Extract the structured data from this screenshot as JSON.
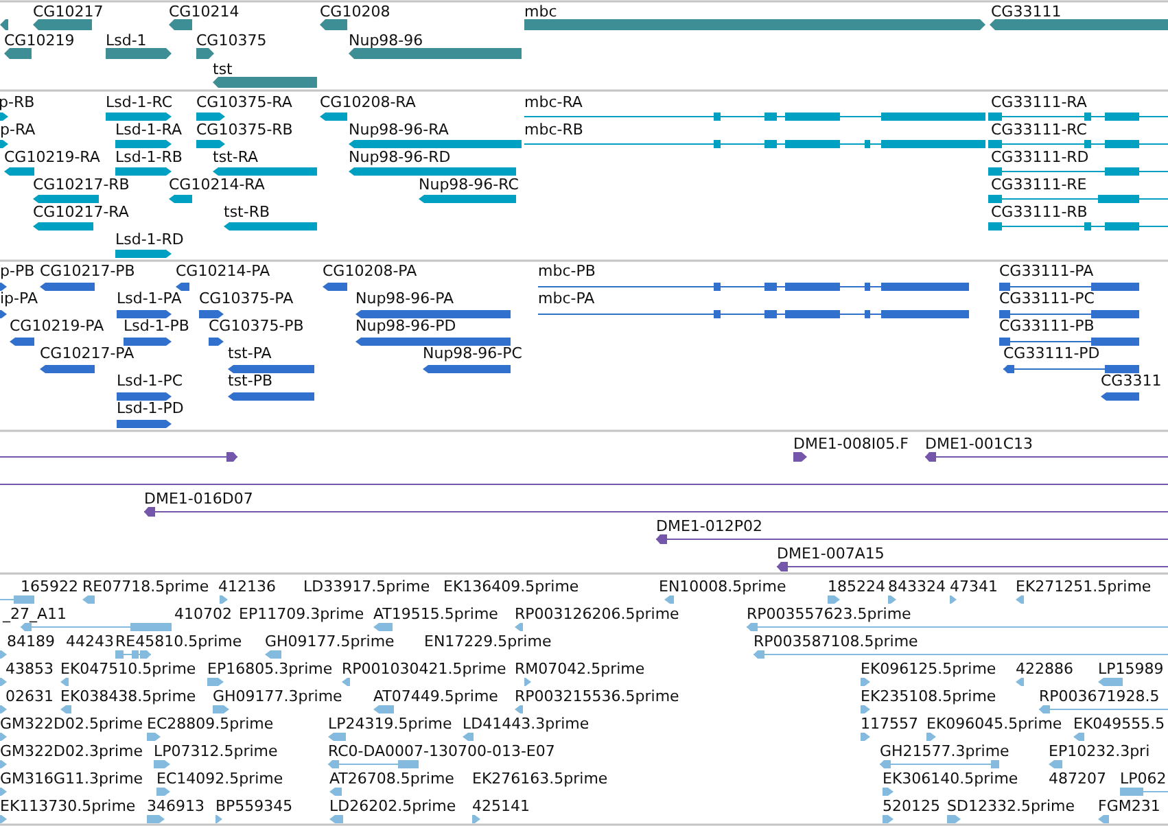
{
  "tracks": [
    {
      "kind": "gene",
      "rows": [
        {
          "features": [
            {
              "reverse": true
            },
            {
              "label": "CG10217",
              "reverse": true
            },
            {
              "label": "CG10214",
              "reverse": true
            },
            {
              "label": "CG10208",
              "reverse": true
            },
            {
              "label": "mbc",
              "reverse": false
            },
            {
              "label": "CG33111",
              "reverse": true
            }
          ]
        },
        {
          "features": [
            {
              "label": "CG10219",
              "reverse": true
            },
            {
              "label": "Lsd-1",
              "reverse": false
            },
            {
              "label": "CG10375",
              "reverse": false
            },
            {
              "label": "Nup98-96",
              "reverse": true
            }
          ]
        },
        {
          "features": [
            {
              "label": "tst",
              "reverse": true
            }
          ]
        }
      ]
    },
    {
      "kind": "transcript",
      "rows": [
        {
          "features": [
            {
              "label": "p-RB",
              "reverse": false
            },
            {
              "label": "Lsd-1-RC",
              "reverse": false
            },
            {
              "label": "CG10375-RA",
              "reverse": false
            },
            {
              "label": "CG10208-RA",
              "reverse": true
            },
            {
              "label": "mbc-RA",
              "reverse": false
            },
            {
              "label": "CG33111-RA",
              "reverse": true
            }
          ]
        },
        {
          "features": [
            {
              "label": "p-RA",
              "reverse": false
            },
            {
              "label": "Lsd-1-RA",
              "reverse": false
            },
            {
              "label": "CG10375-RB",
              "reverse": false
            },
            {
              "label": "Nup98-96-RA",
              "reverse": true
            },
            {
              "label": "mbc-RB",
              "reverse": false
            },
            {
              "label": "CG33111-RC",
              "reverse": true
            }
          ]
        },
        {
          "features": [
            {
              "label": "CG10219-RA",
              "reverse": true
            },
            {
              "label": "Lsd-1-RB",
              "reverse": false
            },
            {
              "label": "tst-RA",
              "reverse": true
            },
            {
              "label": "Nup98-96-RD",
              "reverse": true
            },
            {
              "label": "CG33111-RD",
              "reverse": true
            }
          ]
        },
        {
          "features": [
            {
              "label": "CG10217-RB",
              "reverse": true
            },
            {
              "label": "CG10214-RA",
              "reverse": true
            },
            {
              "label": "Nup98-96-RC",
              "reverse": true
            },
            {
              "label": "CG33111-RE",
              "reverse": true
            }
          ]
        },
        {
          "features": [
            {
              "label": "CG10217-RA",
              "reverse": true
            },
            {
              "label": "tst-RB",
              "reverse": true
            },
            {
              "label": "CG33111-RB",
              "reverse": true
            }
          ]
        },
        {
          "features": [
            {
              "label": "Lsd-1-RD",
              "reverse": false
            }
          ]
        }
      ]
    },
    {
      "kind": "protein",
      "rows": [
        {
          "features": [
            {
              "label": "p-PB",
              "reverse": false
            },
            {
              "label": "CG10217-PB",
              "reverse": true
            },
            {
              "label": "CG10214-PA",
              "reverse": true
            },
            {
              "label": "CG10208-PA",
              "reverse": true
            },
            {
              "label": "mbc-PB",
              "reverse": false
            },
            {
              "label": "CG33111-PA",
              "reverse": true
            }
          ]
        },
        {
          "features": [
            {
              "label": "ip-PA",
              "reverse": false
            },
            {
              "label": "Lsd-1-PA",
              "reverse": false
            },
            {
              "label": "CG10375-PA",
              "reverse": false
            },
            {
              "label": "Nup98-96-PA",
              "reverse": true
            },
            {
              "label": "mbc-PA",
              "reverse": false
            },
            {
              "label": "CG33111-PC",
              "reverse": true
            }
          ]
        },
        {
          "features": [
            {
              "label": "CG10219-PA",
              "reverse": true
            },
            {
              "label": "Lsd-1-PB",
              "reverse": false
            },
            {
              "label": "CG10375-PB",
              "reverse": false
            },
            {
              "label": "Nup98-96-PD",
              "reverse": true
            },
            {
              "label": "CG33111-PB",
              "reverse": true
            }
          ]
        },
        {
          "features": [
            {
              "label": "CG10217-PA",
              "reverse": true
            },
            {
              "label": "tst-PA",
              "reverse": true
            },
            {
              "label": "Nup98-96-PC",
              "reverse": true
            },
            {
              "label": "CG33111-PD",
              "reverse": true
            }
          ]
        },
        {
          "features": [
            {
              "label": "Lsd-1-PC",
              "reverse": false
            },
            {
              "label": "tst-PB",
              "reverse": true
            },
            {
              "label": "CG3311",
              "reverse": true
            }
          ]
        },
        {
          "features": [
            {
              "label": "Lsd-1-PD",
              "reverse": false
            }
          ]
        }
      ]
    },
    {
      "kind": "clone",
      "rows": [
        {
          "features": [
            {
              "reverse": false
            },
            {
              "label": "DME1-008I05.F",
              "reverse": false
            },
            {
              "label": "DME1-001C13",
              "reverse": true
            }
          ]
        },
        {
          "features": [
            {
              "both_ends_offscreen": true
            }
          ]
        },
        {
          "features": [
            {
              "label": "DME1-016D07",
              "reverse": true
            }
          ]
        },
        {
          "features": [
            {
              "label": "DME1-012P02",
              "reverse": true
            }
          ]
        },
        {
          "features": [
            {
              "label": "DME1-007A15",
              "reverse": true
            }
          ]
        }
      ]
    },
    {
      "kind": "est",
      "rows": [
        {
          "features": [
            {
              "label": "165922",
              "reverse": false
            },
            {
              "label": "RE07718.5prime",
              "reverse": true
            },
            {
              "label": "412136",
              "reverse": false
            },
            {
              "label": "LD33917.5prime"
            },
            {
              "label": "EK136409.5prime"
            },
            {
              "label": "EN10008.5prime",
              "reverse": true
            },
            {
              "label": "185224",
              "reverse": false
            },
            {
              "label": "843324",
              "reverse": false
            },
            {
              "label": "47341",
              "reverse": false
            },
            {
              "label": "EK271251.5prime",
              "reverse": true
            }
          ]
        },
        {
          "features": [
            {
              "label": "_27_A11",
              "reverse": true
            },
            {
              "label": "410702"
            },
            {
              "label": "EP11709.3prime"
            },
            {
              "label": "AT19515.5prime",
              "reverse": true
            },
            {
              "label": "RP003126206.5prime",
              "reverse": true
            },
            {
              "label": "RP003557623.5prime",
              "reverse": true
            }
          ]
        },
        {
          "features": [
            {
              "label": "84189",
              "reverse": false
            },
            {
              "label": "44243"
            },
            {
              "label": "RE45810.5prime",
              "reverse": false
            },
            {
              "label": "GH09177.5prime",
              "reverse": true
            },
            {
              "label": "EN17229.5prime"
            },
            {
              "label": "RP003587108.5prime",
              "reverse": true
            }
          ]
        },
        {
          "features": [
            {
              "label": "43853",
              "reverse": false
            },
            {
              "label": "EK047510.5prime",
              "reverse": true
            },
            {
              "label": "EP16805.3prime",
              "reverse": false
            },
            {
              "label": "RP001030421.5prime",
              "reverse": true
            },
            {
              "label": "RM07042.5prime",
              "reverse": false
            },
            {
              "label": "EK096125.5prime",
              "reverse": false
            },
            {
              "label": "422886",
              "reverse": true
            },
            {
              "label": "LP15989",
              "reverse": true
            }
          ]
        },
        {
          "features": [
            {
              "label": "02631",
              "reverse": false
            },
            {
              "label": "EK038438.5prime",
              "reverse": true
            },
            {
              "label": "GH09177.3prime",
              "reverse": false
            },
            {
              "label": "AT07449.5prime",
              "reverse": true
            },
            {
              "label": "RP003215536.5prime",
              "reverse": true
            },
            {
              "label": "EK235108.5prime",
              "reverse": false
            },
            {
              "label": "RP003671928.5",
              "reverse": true
            }
          ]
        },
        {
          "features": [
            {
              "label": "GM322D02.5prime",
              "reverse": false
            },
            {
              "label": "EC28809.5prime",
              "reverse": false
            },
            {
              "label": "LP24319.5prime",
              "reverse": true
            },
            {
              "label": "LD41443.3prime",
              "reverse": true
            },
            {
              "label": "117557",
              "reverse": false
            },
            {
              "label": "EK096045.5prime",
              "reverse": false
            },
            {
              "label": "EK049555.5",
              "reverse": true
            }
          ]
        },
        {
          "features": [
            {
              "label": "GM322D02.3prime",
              "reverse": false
            },
            {
              "label": "LP07312.5prime",
              "reverse": false
            },
            {
              "label": "RC0-DA0007-130700-013-E07",
              "reverse": true
            },
            {
              "label": "GH21577.3prime",
              "reverse": true
            },
            {
              "label": "EP10232.3pri",
              "reverse": true
            }
          ]
        },
        {
          "features": [
            {
              "label": "GM316G11.3prime",
              "reverse": false
            },
            {
              "label": "EC14092.5prime",
              "reverse": false
            },
            {
              "label": "AT26708.5prime",
              "reverse": true
            },
            {
              "label": "EK276163.5prime"
            },
            {
              "label": "EK306140.5prime",
              "reverse": false
            },
            {
              "label": "487207"
            },
            {
              "label": "LP062",
              "reverse": true
            }
          ]
        },
        {
          "features": [
            {
              "label": "EK113730.5prime",
              "reverse": false
            },
            {
              "label": "346913",
              "reverse": false
            },
            {
              "label": "BP559345",
              "reverse": false
            },
            {
              "label": "LD26202.5prime",
              "reverse": true
            },
            {
              "label": "425141",
              "reverse": false
            },
            {
              "label": "520125",
              "reverse": false
            },
            {
              "label": "SD12332.5prime",
              "reverse": false
            },
            {
              "label": "FGM231",
              "reverse": true
            }
          ]
        }
      ]
    }
  ]
}
